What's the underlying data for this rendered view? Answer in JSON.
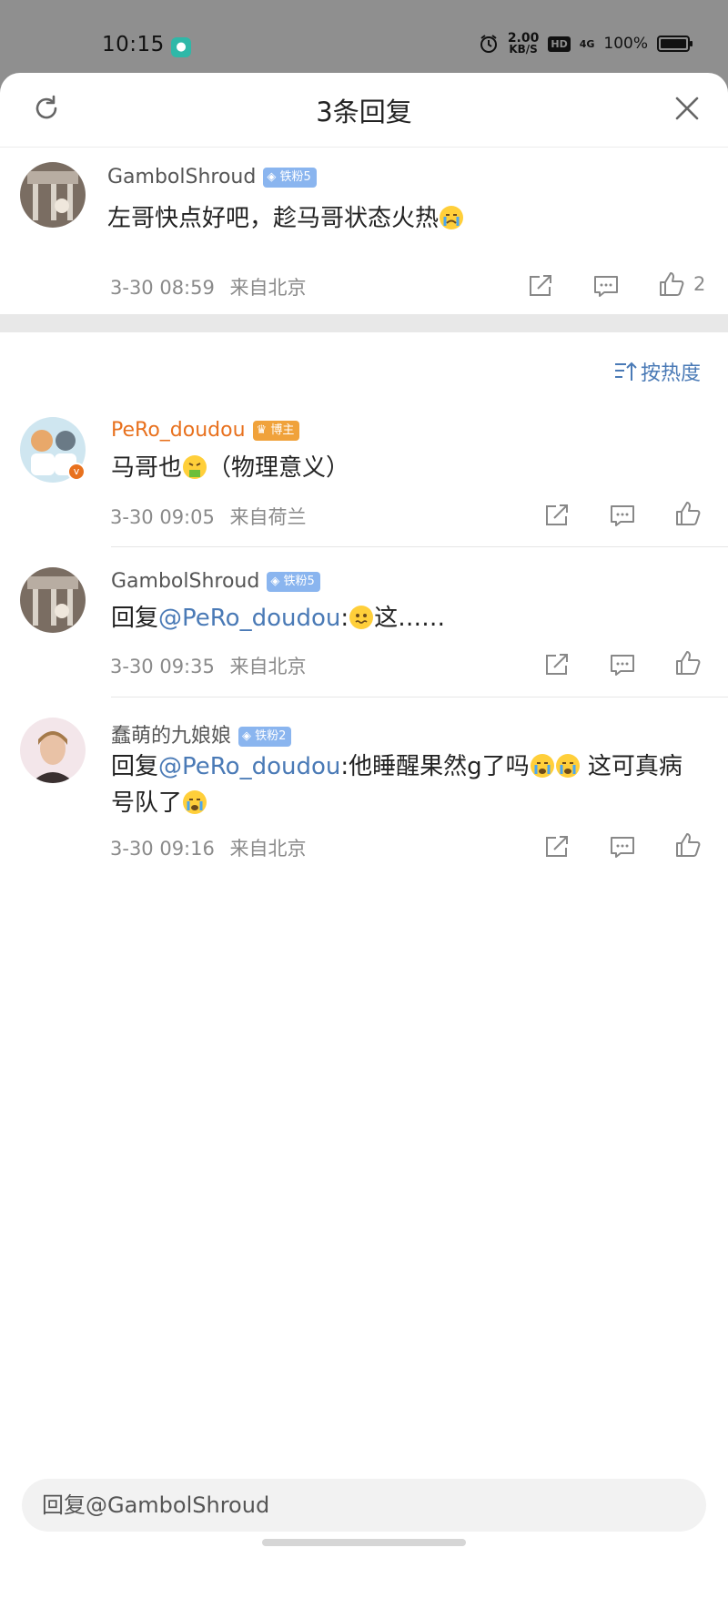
{
  "status_bar": {
    "time": "10:15",
    "app_icon": "message-app-icon",
    "speed_value": "2.00",
    "speed_unit": "KB/S",
    "hd": "HD",
    "signal": "4G",
    "battery": "100%"
  },
  "header": {
    "title": "3条回复",
    "refresh_icon": "refresh-icon",
    "close_icon": "close-icon"
  },
  "root_comment": {
    "user": "GambolShroud",
    "badge": "铁粉5",
    "text": "左哥快点好吧，趁马哥状态火热",
    "time": "3-30 08:59",
    "location": "来自北京",
    "like_count": "2"
  },
  "sort_label": "按热度",
  "replies": [
    {
      "user": "PeRo_doudou",
      "badge": "博主",
      "text_before": "马哥也",
      "text_after": "（物理意义）",
      "time": "3-30 09:05",
      "location": "来自荷兰"
    },
    {
      "user": "GambolShroud",
      "badge": "铁粉5",
      "text_prefix": "回复",
      "mention": "@PeRo_doudou",
      "text_after": ":",
      "text_end": "这……",
      "time": "3-30 09:35",
      "location": "来自北京"
    },
    {
      "user": "蠢萌的九娘娘",
      "badge": "铁粉2",
      "text_prefix": "回复",
      "mention": "@PeRo_doudou",
      "text_line1": ":他睡醒果然g了吗",
      "text_line1_end": " 这可真病",
      "text_line2": "号队了",
      "time": "3-30 09:16",
      "location": "来自北京"
    }
  ],
  "reply_input": {
    "placeholder": "回复@GambolShroud"
  },
  "colors": {
    "accent_link": "#4a7ab6",
    "blogger_name": "#e8711e",
    "fan_badge": "#8ab5ef",
    "blogger_badge": "#f0a23b"
  }
}
